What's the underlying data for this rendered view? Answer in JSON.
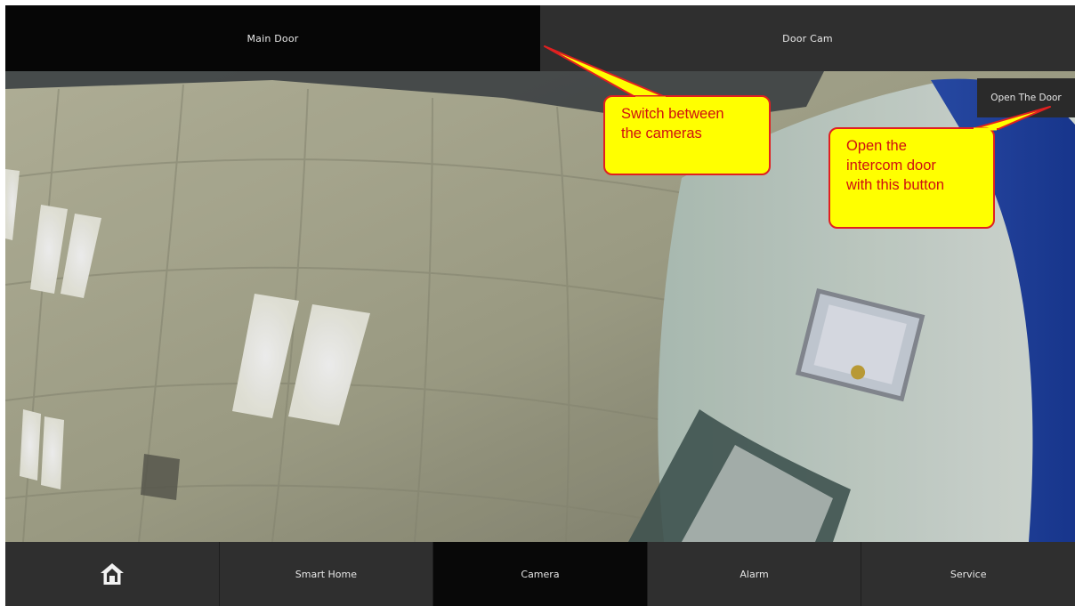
{
  "camera_tabs": [
    {
      "label": "Main Door",
      "active": true
    },
    {
      "label": "Door Cam",
      "active": false
    }
  ],
  "video": {
    "open_door_label": "Open The Door"
  },
  "bottom_nav": {
    "home_icon": "home-icon",
    "items": [
      {
        "label": "Smart Home",
        "active": false
      },
      {
        "label": "Camera",
        "active": true
      },
      {
        "label": "Alarm",
        "active": false
      },
      {
        "label": "Service",
        "active": false
      }
    ]
  },
  "annotations": {
    "switch_cameras": "Switch between\nthe cameras",
    "open_door": "Open the\nintercom door\nwith this button"
  },
  "colors": {
    "callout_fill": "#ffff00",
    "callout_border": "#e02020",
    "callout_text": "#d01010",
    "tab_active": "#060606",
    "tab_inactive": "#2f2f2f"
  }
}
